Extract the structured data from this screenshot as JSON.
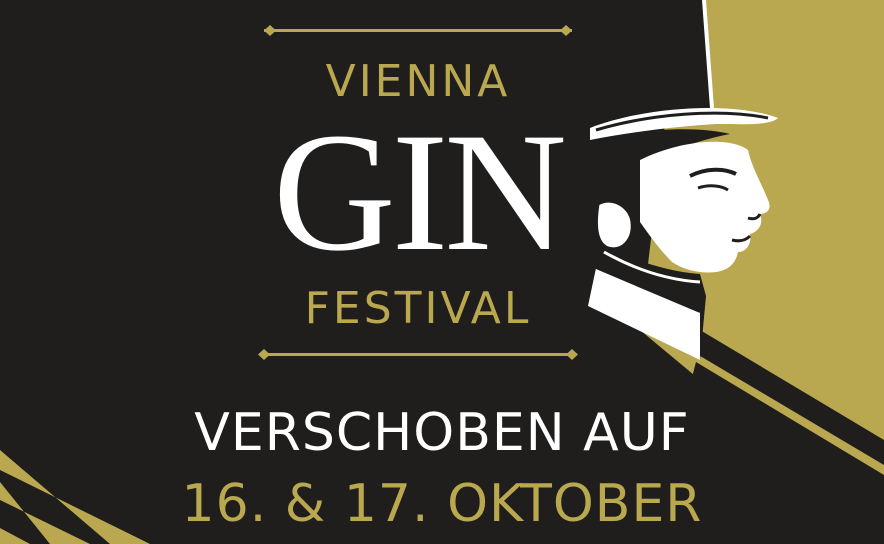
{
  "logo": {
    "line1": "VIENNA",
    "line2": "GIN",
    "line3": "FESTIVAL"
  },
  "announcement": {
    "headline": "VERSCHOBEN AUF",
    "dates": "16. & 17. OKTOBER"
  },
  "colors": {
    "background": "#1f1e1c",
    "gold": "#b9a84f",
    "white": "#ffffff"
  },
  "illustration": "gentleman-in-top-hat-profile"
}
